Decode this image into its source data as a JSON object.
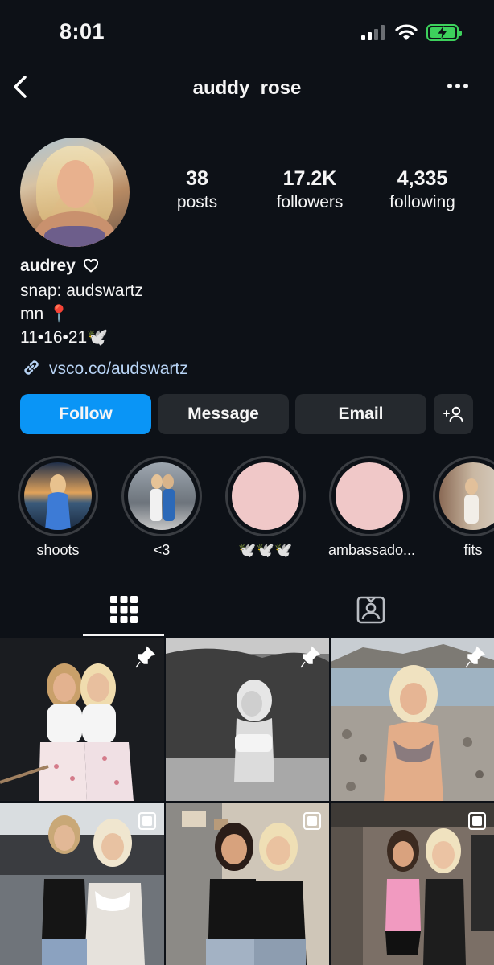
{
  "status_bar": {
    "time": "8:01",
    "signal_icon": "cellular-signal-icon",
    "wifi_icon": "wifi-icon",
    "battery_icon": "battery-charging-icon"
  },
  "header": {
    "username": "auddy_rose",
    "back_icon": "chevron-left-icon",
    "more_icon": "more-horizontal-icon"
  },
  "stats": {
    "posts": {
      "value": "38",
      "label": "posts"
    },
    "followers": {
      "value": "17.2K",
      "label": "followers"
    },
    "following": {
      "value": "4,335",
      "label": "following"
    }
  },
  "bio": {
    "name": "audrey",
    "lines": [
      "snap: audswartz",
      "mn 📍",
      "11•16•21🕊️"
    ],
    "link": "vsco.co/audswartz"
  },
  "actions": {
    "follow": "Follow",
    "message": "Message",
    "email": "Email",
    "add_friend_icon": "add-person-icon"
  },
  "highlights": [
    {
      "label": "shoots"
    },
    {
      "label": "<3"
    },
    {
      "label": "🕊️🕊️🕊️"
    },
    {
      "label": "ambassado..."
    },
    {
      "label": "fits"
    }
  ],
  "tabs": {
    "grid_icon": "grid-icon",
    "tagged_icon": "tagged-person-icon",
    "active": "grid"
  },
  "colors": {
    "accent": "#0a95f6",
    "background": "#0d1117",
    "button": "#25292e",
    "highlight_placeholder": "#f0c8c8"
  }
}
